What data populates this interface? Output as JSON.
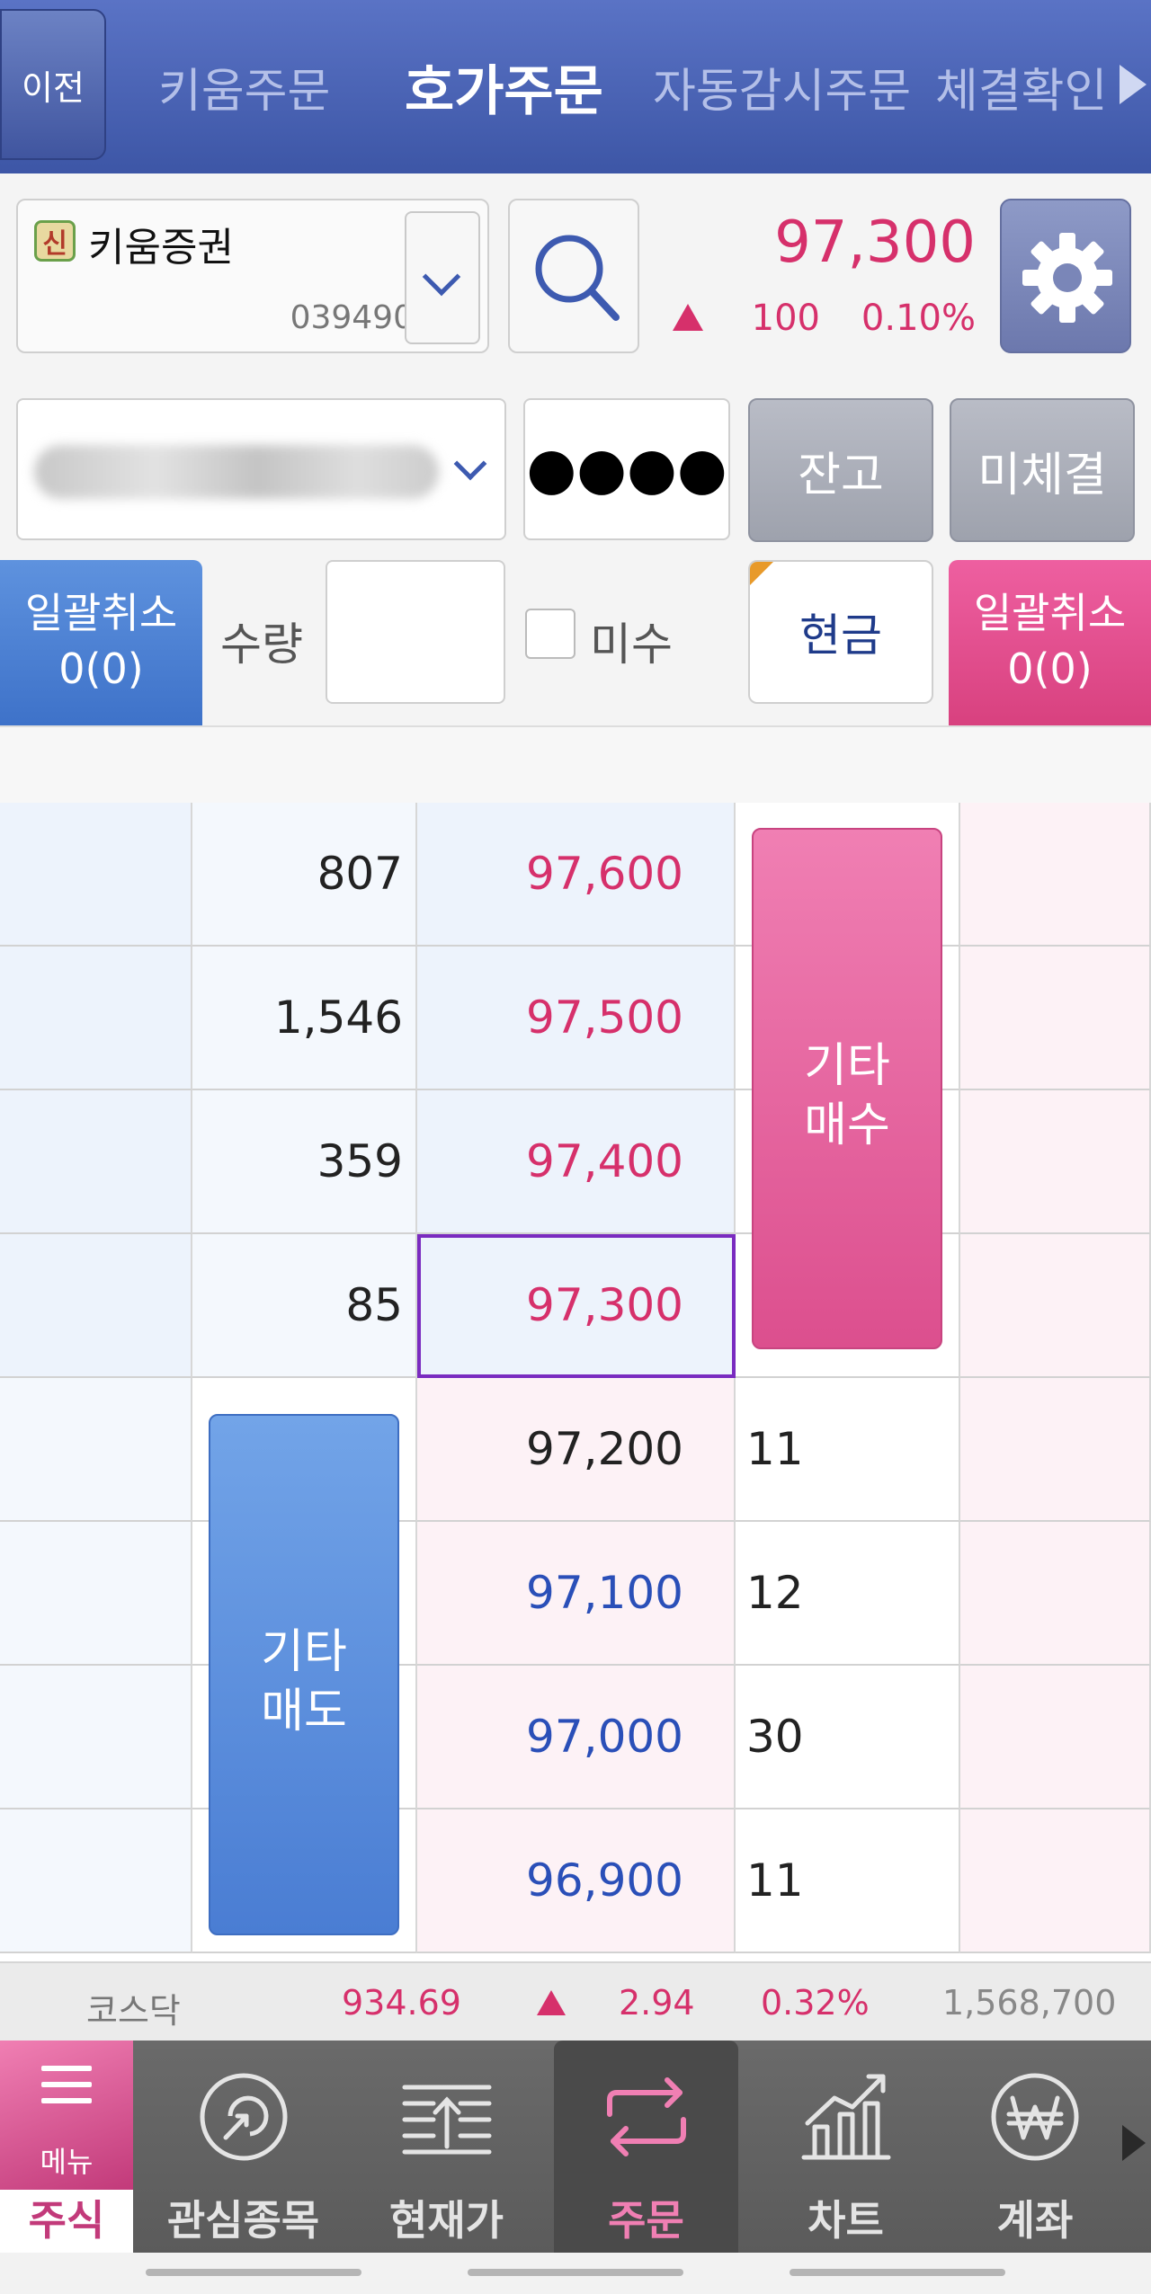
{
  "topnav": {
    "prev_label": "이전",
    "tabs": [
      {
        "label": "키움주문",
        "active": false
      },
      {
        "label": "호가주문",
        "active": true
      },
      {
        "label": "자동감시주문",
        "active": false
      },
      {
        "label": "체결확인",
        "active": false
      }
    ]
  },
  "stock": {
    "badge": "신",
    "name": "키움증권",
    "code": "039490",
    "price": "97,300",
    "change": "100",
    "rate": "0.10%"
  },
  "account": {
    "password_mask": "●●●●",
    "balance_label": "잔고",
    "unfilled_label": "미체결"
  },
  "controls": {
    "cancel_all_sell_line1": "일괄취소",
    "cancel_all_sell_line2": "0(0)",
    "qty_label": "수량",
    "misu_label": "미수",
    "cash_label": "현금",
    "cancel_all_buy_line1": "일괄취소",
    "cancel_all_buy_line2": "0(0)"
  },
  "orderbook": {
    "asks": [
      {
        "qty": "807",
        "price": "97,600"
      },
      {
        "qty": "1,546",
        "price": "97,500"
      },
      {
        "qty": "359",
        "price": "97,400"
      },
      {
        "qty": "85",
        "price": "97,300"
      }
    ],
    "bids": [
      {
        "price": "97,200",
        "qty": "11"
      },
      {
        "price": "97,100",
        "qty": "12"
      },
      {
        "price": "97,000",
        "qty": "30"
      },
      {
        "price": "96,900",
        "qty": "11"
      }
    ],
    "etc_buy_line1": "기타",
    "etc_buy_line2": "매수",
    "etc_sell_line1": "기타",
    "etc_sell_line2": "매도"
  },
  "index": {
    "name": "코스닥",
    "value": "934.69",
    "change": "2.94",
    "rate": "0.32%",
    "volume": "1,568,700"
  },
  "bottomnav": {
    "menu_label": "메뉴",
    "stock_label": "주식",
    "items": [
      {
        "label": "관심종목",
        "icon": "watchlist-icon"
      },
      {
        "label": "현재가",
        "icon": "current-price-icon"
      },
      {
        "label": "주문",
        "icon": "order-icon",
        "active": true
      },
      {
        "label": "차트",
        "icon": "chart-icon"
      },
      {
        "label": "계좌",
        "icon": "account-won-icon"
      }
    ]
  },
  "colors": {
    "up": "#d6306b",
    "down": "#2a4fb8",
    "nav": "#3d56a6",
    "accent_pink": "#dc4f8e"
  }
}
